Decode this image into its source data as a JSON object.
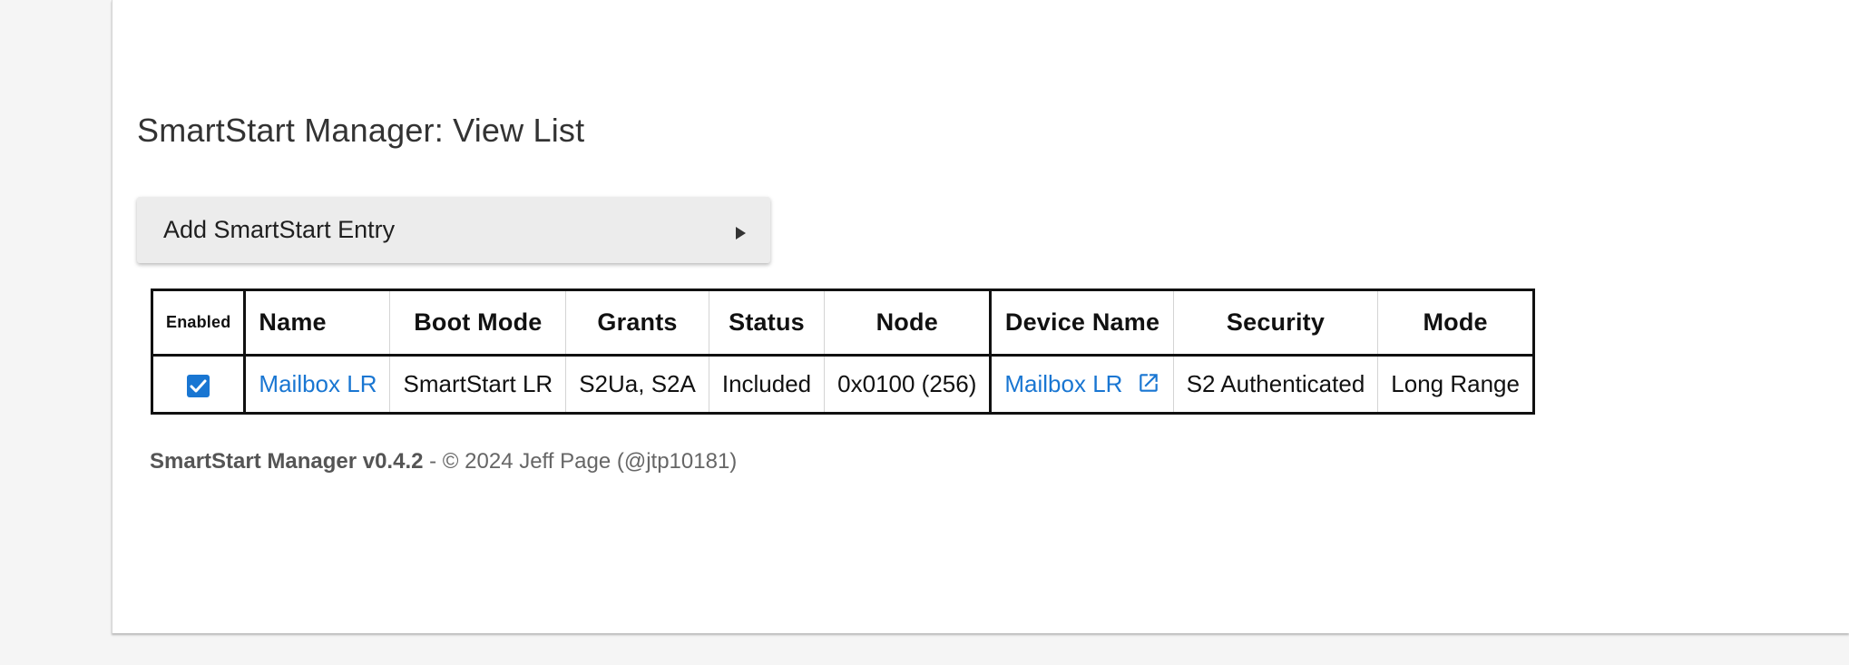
{
  "page": {
    "title": "SmartStart Manager: View List"
  },
  "accordion": {
    "label": "Add SmartStart Entry"
  },
  "table": {
    "headers": {
      "enabled": "Enabled",
      "name": "Name",
      "boot_mode": "Boot Mode",
      "grants": "Grants",
      "status": "Status",
      "node": "Node",
      "device_name": "Device Name",
      "security": "Security",
      "mode": "Mode"
    },
    "rows": [
      {
        "enabled": true,
        "name": "Mailbox LR",
        "boot_mode": "SmartStart LR",
        "grants": "S2Ua, S2A",
        "status": "Included",
        "node": "0x0100 (256)",
        "device_name": "Mailbox LR",
        "security": "S2 Authenticated",
        "mode": "Long Range"
      }
    ]
  },
  "footer": {
    "app_version": "SmartStart Manager v0.4.2",
    "copyright": " - © 2024 Jeff Page (@jtp10181)"
  },
  "colors": {
    "link": "#1976d2",
    "checkbox": "#1976d2",
    "accordion_bg": "#ececec",
    "page_bg": "#f5f5f5"
  },
  "icons": {
    "accordion_arrow": "triangle-right-icon",
    "checkbox": "check-icon",
    "device_link": "external-link-icon"
  }
}
